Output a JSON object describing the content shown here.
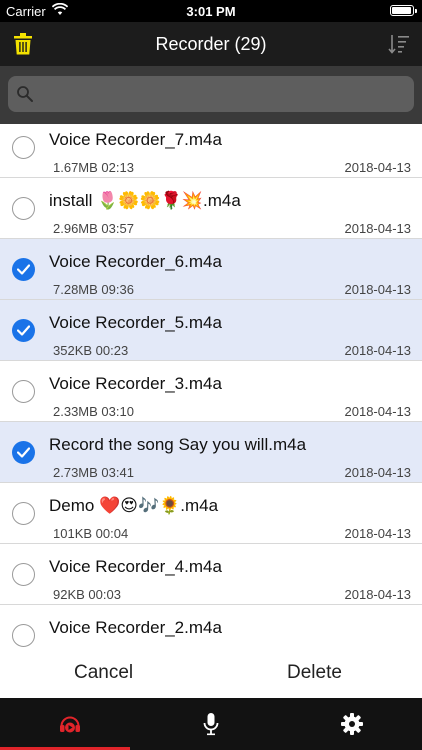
{
  "status_bar": {
    "carrier": "Carrier",
    "time": "3:01 PM"
  },
  "nav": {
    "title": "Recorder (29)",
    "trash_icon": "trash-icon",
    "sort_icon": "sort-icon",
    "accent": "#f4e200"
  },
  "search": {
    "placeholder": "",
    "value": ""
  },
  "recordings": [
    {
      "name": "Voice Recorder_7.m4a",
      "meta": "1.67MB 02:13",
      "date": "2018-04-13",
      "selected": false
    },
    {
      "name": "install 🌷🌼🌼🌹💥.m4a",
      "meta": "2.96MB 03:57",
      "date": "2018-04-13",
      "selected": false
    },
    {
      "name": "Voice Recorder_6.m4a",
      "meta": "7.28MB 09:36",
      "date": "2018-04-13",
      "selected": true
    },
    {
      "name": "Voice Recorder_5.m4a",
      "meta": "352KB 00:23",
      "date": "2018-04-13",
      "selected": true
    },
    {
      "name": "Voice Recorder_3.m4a",
      "meta": "2.33MB 03:10",
      "date": "2018-04-13",
      "selected": false
    },
    {
      "name": "Record the song Say you will.m4a",
      "meta": "2.73MB 03:41",
      "date": "2018-04-13",
      "selected": true
    },
    {
      "name": "Demo ❤️😍🎶🌻.m4a",
      "meta": "101KB 00:04",
      "date": "2018-04-13",
      "selected": false
    },
    {
      "name": "Voice Recorder_4.m4a",
      "meta": "92KB 00:03",
      "date": "2018-04-13",
      "selected": false
    },
    {
      "name": "Voice Recorder_2.m4a",
      "meta": "",
      "date": "",
      "selected": false
    }
  ],
  "actions": {
    "cancel": "Cancel",
    "delete": "Delete"
  },
  "tabs": [
    {
      "icon": "recordings-play-icon",
      "active": true,
      "color": "#e1242a"
    },
    {
      "icon": "microphone-icon",
      "active": false,
      "color": "#ffffff"
    },
    {
      "icon": "gear-icon",
      "active": false,
      "color": "#ffffff"
    }
  ],
  "colors": {
    "selected_row": "#e3e9f8",
    "check_blue": "#1a73e8"
  }
}
